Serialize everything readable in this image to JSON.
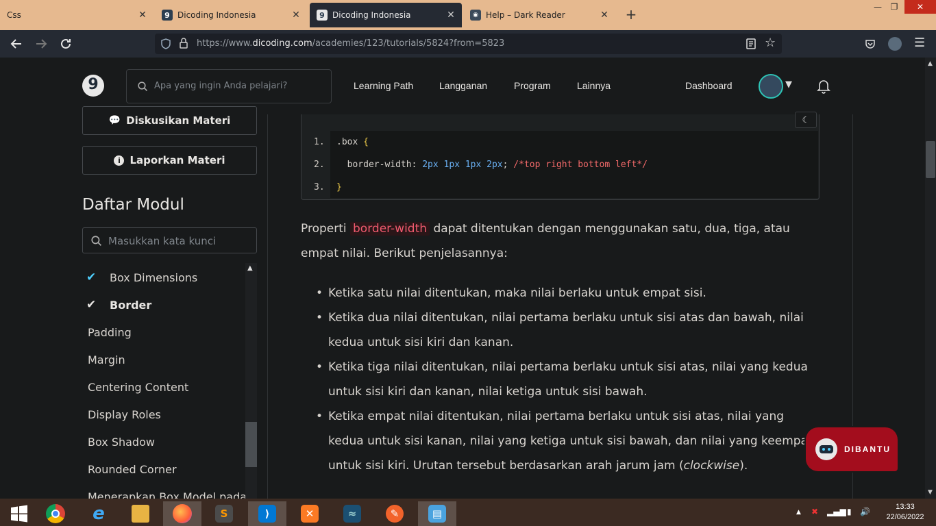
{
  "browser": {
    "tabs": [
      {
        "title": "Css",
        "active": false
      },
      {
        "title": "Dicoding Indonesia",
        "active": false
      },
      {
        "title": "Dicoding Indonesia",
        "active": true
      },
      {
        "title": "Help – Dark Reader",
        "active": false
      }
    ],
    "url_prefix": "https://www.",
    "url_domain": "dicoding.com",
    "url_path": "/academies/123/tutorials/5824?from=5823"
  },
  "header": {
    "search_placeholder": "Apa yang ingin Anda pelajari?",
    "menu": [
      "Learning Path",
      "Langganan",
      "Program",
      "Lainnya"
    ],
    "dashboard": "Dashboard"
  },
  "sidebar": {
    "discuss_label": "Diskusikan Materi",
    "report_label": "Laporkan Materi",
    "module_title": "Daftar Modul",
    "module_search_placeholder": "Masukkan kata kunci",
    "items": [
      {
        "label": "Box Dimensions",
        "done": true
      },
      {
        "label": "Border",
        "done": true,
        "current": true
      },
      {
        "label": "Padding",
        "done": false
      },
      {
        "label": "Margin",
        "done": false
      },
      {
        "label": "Centering Content",
        "done": false
      },
      {
        "label": "Display Roles",
        "done": false
      },
      {
        "label": "Box Shadow",
        "done": false
      },
      {
        "label": "Rounded Corner",
        "done": false
      },
      {
        "label": "Menerapkan Box Model pada",
        "done": false
      }
    ]
  },
  "code": {
    "line_numbers": [
      "1.",
      "2.",
      "3."
    ],
    "line1_selector": ".box ",
    "line1_brace": "{",
    "line2_prop": "  border-width: ",
    "line2_values": "2px 1px 1px 2px",
    "line2_semicolon": "; ",
    "line2_comment": "/*top right bottom left*/",
    "line3_brace": "}"
  },
  "article": {
    "intro_before": "Properti ",
    "intro_code": "border-width",
    "intro_after": " dapat ditentukan dengan menggunakan satu, dua, tiga, atau empat nilai. Berikut penjelasannya:",
    "bullets": [
      "Ketika satu nilai ditentukan, maka nilai berlaku untuk empat sisi.",
      "Ketika dua nilai ditentukan, nilai pertama berlaku untuk sisi atas dan bawah, nilai kedua untuk sisi kiri dan kanan.",
      "Ketika tiga nilai ditentukan, nilai pertama berlaku untuk sisi atas, nilai yang kedua untuk sisi kiri dan kanan, nilai ketiga untuk sisi bawah."
    ],
    "bullet4_before": "Ketika empat nilai ditentukan, nilai pertama berlaku untuk sisi atas, nilai yang kedua untuk sisi kanan, nilai yang ketiga untuk sisi bawah, dan nilai yang keempat untuk sisi kiri. Urutan tersebut berdasarkan arah jarum jam (",
    "bullet4_em": "clockwise",
    "bullet4_after": ")."
  },
  "dibantu_label": "DIBANTU",
  "taskbar": {
    "time": "13:33",
    "date": "22/06/2022"
  },
  "colors": {
    "accent_check": "#4fd1ff",
    "dibantu_bg": "#a30d1d",
    "tab_bar": "#e6b98f"
  }
}
